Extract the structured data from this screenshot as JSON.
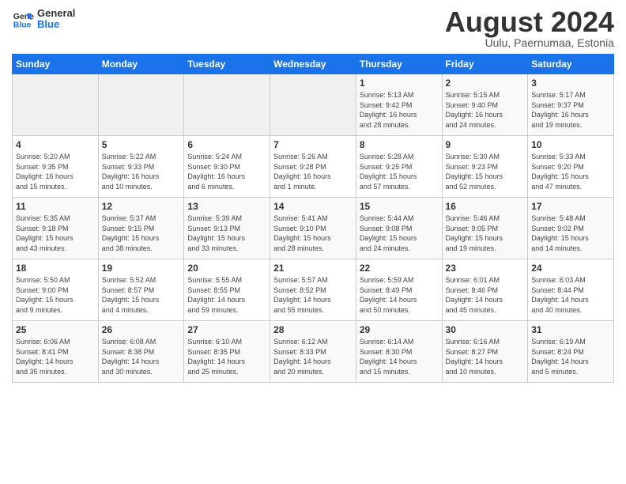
{
  "header": {
    "logo_line1": "General",
    "logo_line2": "Blue",
    "month_title": "August 2024",
    "location": "Uulu, Paernumaa, Estonia"
  },
  "weekdays": [
    "Sunday",
    "Monday",
    "Tuesday",
    "Wednesday",
    "Thursday",
    "Friday",
    "Saturday"
  ],
  "weeks": [
    [
      {
        "day": "",
        "info": ""
      },
      {
        "day": "",
        "info": ""
      },
      {
        "day": "",
        "info": ""
      },
      {
        "day": "",
        "info": ""
      },
      {
        "day": "1",
        "info": "Sunrise: 5:13 AM\nSunset: 9:42 PM\nDaylight: 16 hours\nand 28 minutes."
      },
      {
        "day": "2",
        "info": "Sunrise: 5:15 AM\nSunset: 9:40 PM\nDaylight: 16 hours\nand 24 minutes."
      },
      {
        "day": "3",
        "info": "Sunrise: 5:17 AM\nSunset: 9:37 PM\nDaylight: 16 hours\nand 19 minutes."
      }
    ],
    [
      {
        "day": "4",
        "info": "Sunrise: 5:20 AM\nSunset: 9:35 PM\nDaylight: 16 hours\nand 15 minutes."
      },
      {
        "day": "5",
        "info": "Sunrise: 5:22 AM\nSunset: 9:33 PM\nDaylight: 16 hours\nand 10 minutes."
      },
      {
        "day": "6",
        "info": "Sunrise: 5:24 AM\nSunset: 9:30 PM\nDaylight: 16 hours\nand 6 minutes."
      },
      {
        "day": "7",
        "info": "Sunrise: 5:26 AM\nSunset: 9:28 PM\nDaylight: 16 hours\nand 1 minute."
      },
      {
        "day": "8",
        "info": "Sunrise: 5:28 AM\nSunset: 9:25 PM\nDaylight: 15 hours\nand 57 minutes."
      },
      {
        "day": "9",
        "info": "Sunrise: 5:30 AM\nSunset: 9:23 PM\nDaylight: 15 hours\nand 52 minutes."
      },
      {
        "day": "10",
        "info": "Sunrise: 5:33 AM\nSunset: 9:20 PM\nDaylight: 15 hours\nand 47 minutes."
      }
    ],
    [
      {
        "day": "11",
        "info": "Sunrise: 5:35 AM\nSunset: 9:18 PM\nDaylight: 15 hours\nand 43 minutes."
      },
      {
        "day": "12",
        "info": "Sunrise: 5:37 AM\nSunset: 9:15 PM\nDaylight: 15 hours\nand 38 minutes."
      },
      {
        "day": "13",
        "info": "Sunrise: 5:39 AM\nSunset: 9:13 PM\nDaylight: 15 hours\nand 33 minutes."
      },
      {
        "day": "14",
        "info": "Sunrise: 5:41 AM\nSunset: 9:10 PM\nDaylight: 15 hours\nand 28 minutes."
      },
      {
        "day": "15",
        "info": "Sunrise: 5:44 AM\nSunset: 9:08 PM\nDaylight: 15 hours\nand 24 minutes."
      },
      {
        "day": "16",
        "info": "Sunrise: 5:46 AM\nSunset: 9:05 PM\nDaylight: 15 hours\nand 19 minutes."
      },
      {
        "day": "17",
        "info": "Sunrise: 5:48 AM\nSunset: 9:02 PM\nDaylight: 15 hours\nand 14 minutes."
      }
    ],
    [
      {
        "day": "18",
        "info": "Sunrise: 5:50 AM\nSunset: 9:00 PM\nDaylight: 15 hours\nand 9 minutes."
      },
      {
        "day": "19",
        "info": "Sunrise: 5:52 AM\nSunset: 8:57 PM\nDaylight: 15 hours\nand 4 minutes."
      },
      {
        "day": "20",
        "info": "Sunrise: 5:55 AM\nSunset: 8:55 PM\nDaylight: 14 hours\nand 59 minutes."
      },
      {
        "day": "21",
        "info": "Sunrise: 5:57 AM\nSunset: 8:52 PM\nDaylight: 14 hours\nand 55 minutes."
      },
      {
        "day": "22",
        "info": "Sunrise: 5:59 AM\nSunset: 8:49 PM\nDaylight: 14 hours\nand 50 minutes."
      },
      {
        "day": "23",
        "info": "Sunrise: 6:01 AM\nSunset: 8:46 PM\nDaylight: 14 hours\nand 45 minutes."
      },
      {
        "day": "24",
        "info": "Sunrise: 6:03 AM\nSunset: 8:44 PM\nDaylight: 14 hours\nand 40 minutes."
      }
    ],
    [
      {
        "day": "25",
        "info": "Sunrise: 6:06 AM\nSunset: 8:41 PM\nDaylight: 14 hours\nand 35 minutes."
      },
      {
        "day": "26",
        "info": "Sunrise: 6:08 AM\nSunset: 8:38 PM\nDaylight: 14 hours\nand 30 minutes."
      },
      {
        "day": "27",
        "info": "Sunrise: 6:10 AM\nSunset: 8:35 PM\nDaylight: 14 hours\nand 25 minutes."
      },
      {
        "day": "28",
        "info": "Sunrise: 6:12 AM\nSunset: 8:33 PM\nDaylight: 14 hours\nand 20 minutes."
      },
      {
        "day": "29",
        "info": "Sunrise: 6:14 AM\nSunset: 8:30 PM\nDaylight: 14 hours\nand 15 minutes."
      },
      {
        "day": "30",
        "info": "Sunrise: 6:16 AM\nSunset: 8:27 PM\nDaylight: 14 hours\nand 10 minutes."
      },
      {
        "day": "31",
        "info": "Sunrise: 6:19 AM\nSunset: 8:24 PM\nDaylight: 14 hours\nand 5 minutes."
      }
    ]
  ]
}
